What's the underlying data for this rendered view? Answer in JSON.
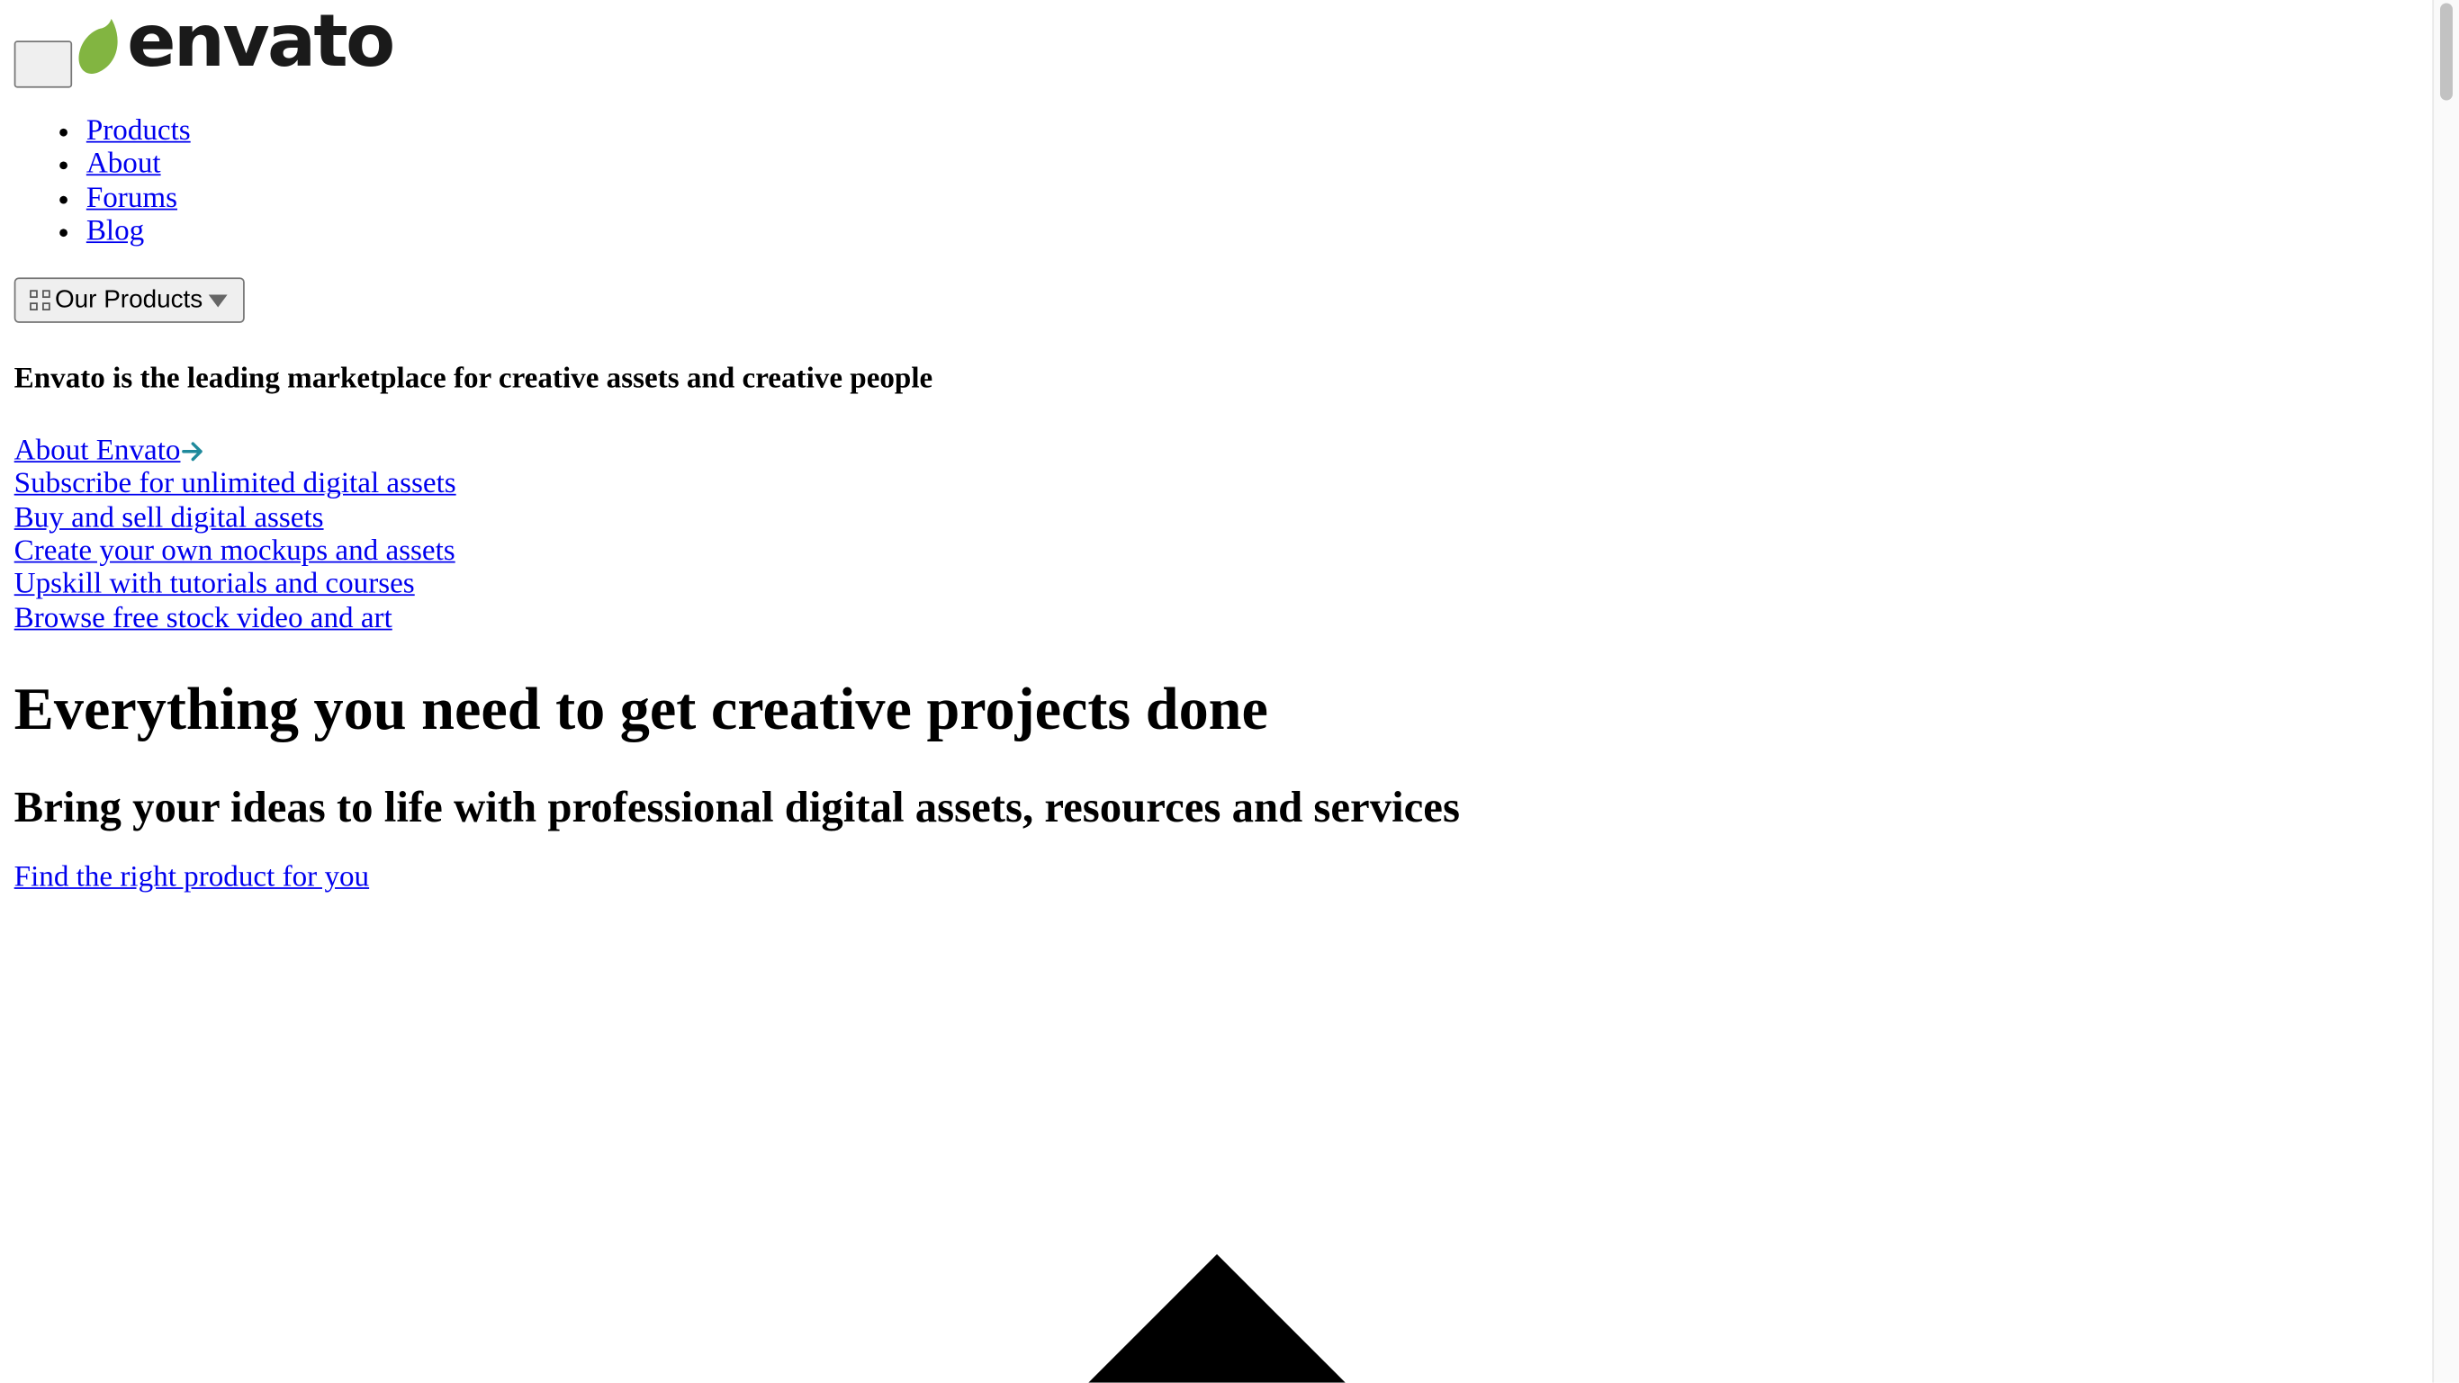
{
  "brand": {
    "name": "envato",
    "leaf_color": "#82b541"
  },
  "nav": {
    "items": [
      {
        "label": "Products"
      },
      {
        "label": "About"
      },
      {
        "label": "Forums"
      },
      {
        "label": "Blog"
      }
    ]
  },
  "products_button": {
    "label": "Our Products",
    "icon": "grid-icon",
    "caret_icon": "caret-down-icon"
  },
  "tagline": "Envato is the leading marketplace for creative assets and creative people",
  "links": {
    "about": "About Envato",
    "about_icon": "arrow-right-icon",
    "arrow_color": "#1f8a9c",
    "items": [
      {
        "label": "Subscribe for unlimited digital assets"
      },
      {
        "label": "Buy and sell digital assets"
      },
      {
        "label": "Create your own mockups and assets"
      },
      {
        "label": "Upskill with tutorials and courses"
      },
      {
        "label": "Browse free stock video and art"
      }
    ]
  },
  "hero": {
    "title": "Everything you need to get creative projects done",
    "subtitle": "Bring your ideas to life with professional digital assets, resources and services",
    "cta": "Find the right product for you"
  },
  "colors": {
    "link": "#0000ee",
    "text": "#000000"
  }
}
